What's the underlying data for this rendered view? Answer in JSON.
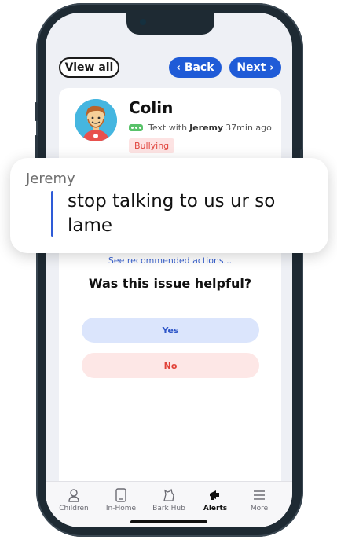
{
  "nav": {
    "view_all": "View all",
    "back": "Back",
    "next": "Next"
  },
  "alert": {
    "child_name": "Colin",
    "channel": "Text with",
    "contact": "Jeremy",
    "time_ago": "37min ago",
    "category": "Bullying",
    "see_actions": "See recommended actions...",
    "question": "Was this issue helpful?",
    "yes_label": "Yes",
    "no_label": "No"
  },
  "message": {
    "sender": "Jeremy",
    "text": "stop talking to us ur so lame"
  },
  "tabs": [
    {
      "label": "Children",
      "icon": "child-icon"
    },
    {
      "label": "In-Home",
      "icon": "tablet-icon"
    },
    {
      "label": "Bark Hub",
      "icon": "dog-icon"
    },
    {
      "label": "Alerts",
      "icon": "megaphone-icon"
    },
    {
      "label": "More",
      "icon": "menu-icon"
    }
  ],
  "colors": {
    "primary": "#1f5bd7",
    "danger": "#e0463e",
    "badge_bg": "#fde3e3"
  }
}
